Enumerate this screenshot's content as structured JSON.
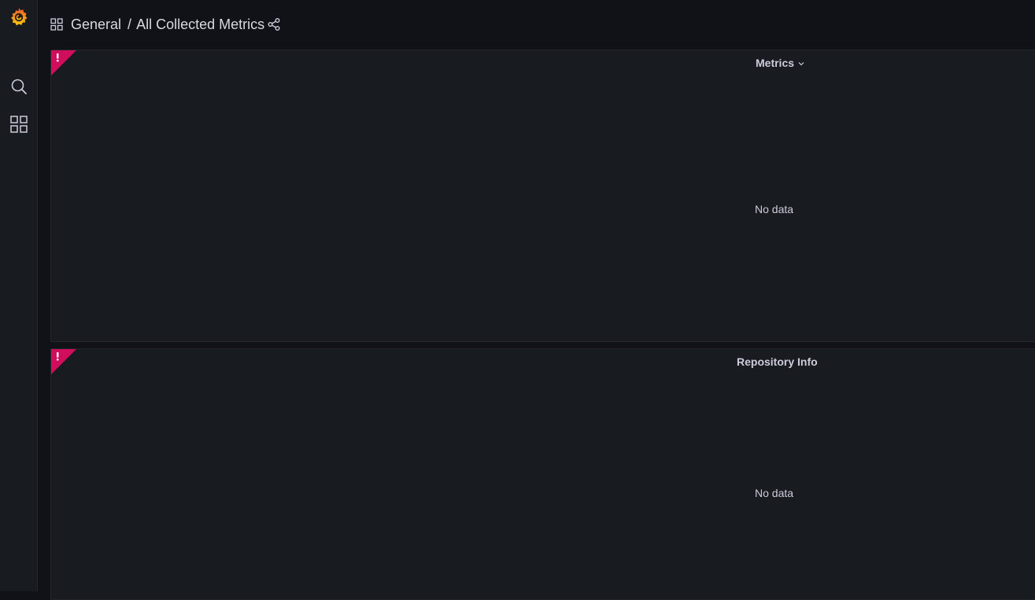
{
  "sidebar": {
    "logo": "grafana-logo-icon",
    "items": [
      {
        "icon": "search-icon"
      },
      {
        "icon": "dashboards-icon"
      }
    ]
  },
  "header": {
    "folder_icon": "dashboard-grid-icon",
    "folder": "General",
    "separator": "/",
    "dashboard": "All Collected Metrics",
    "share_icon": "share-icon"
  },
  "panels": [
    {
      "title": "Metrics",
      "has_menu_chevron": true,
      "status": "error",
      "message": "No data"
    },
    {
      "title": "Repository Info",
      "has_menu_chevron": false,
      "status": "error",
      "message": "No data"
    }
  ],
  "colors": {
    "error": "#d10e5c",
    "logo_orange": "#f7941d",
    "logo_yellow": "#fbca0a"
  }
}
